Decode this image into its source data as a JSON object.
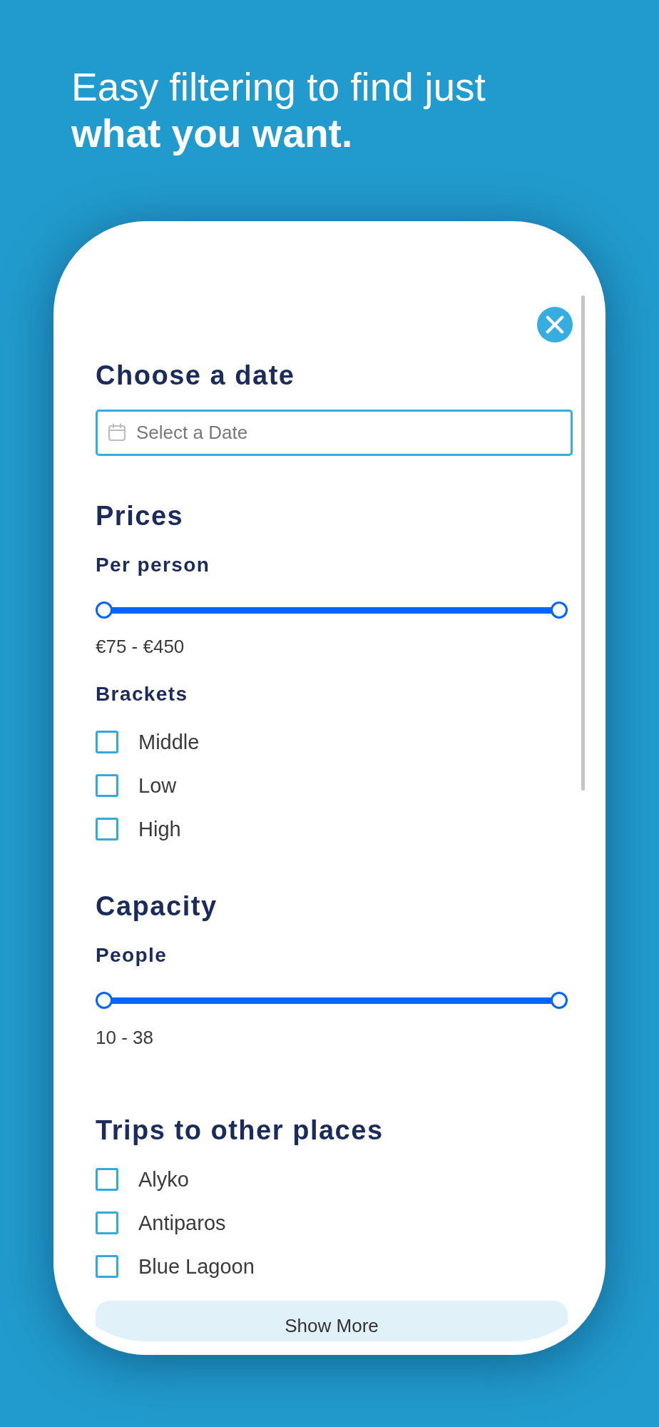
{
  "headline": "Easy filtering to find just **what you want.**",
  "date": {
    "title": "Choose a date",
    "date_field": {
      "placeholder": "Select a Date"
    }
  },
  "prices": {
    "title": "Prices",
    "slider_label": "Per person",
    "slider": {
      "thumbs": [
        {
          "level": 0
        },
        {
          "level": 1
        }
      ]
    },
    "range_text": "€75 - €450",
    "brackets_label": "Brackets",
    "brackets": [
      {
        "label": "Middle",
        "checked": false
      },
      {
        "label": "Low",
        "checked": false
      },
      {
        "label": "High",
        "checked": false
      }
    ]
  },
  "capacity": {
    "title": "Capacity",
    "slider_label": "People",
    "slider": {
      "thumbs": [
        {
          "level": 0
        },
        {
          "level": 1
        }
      ]
    },
    "range_text": "10 - 38"
  },
  "places": {
    "title": "Trips to other places",
    "items": [
      {
        "label": "Alyko",
        "checked": false
      },
      {
        "label": "Antiparos",
        "checked": false
      },
      {
        "label": "Blue Lagoon",
        "checked": false
      }
    ],
    "show_more_button": "Show More"
  }
}
